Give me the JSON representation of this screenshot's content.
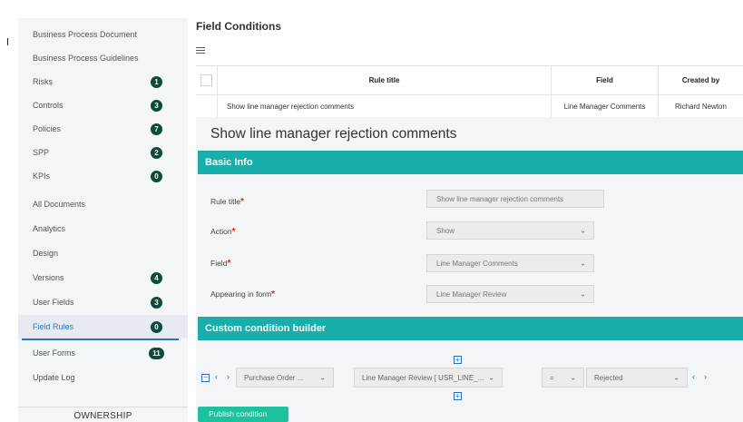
{
  "sidebar": {
    "items": [
      {
        "label": "Business Process Document",
        "badge": ""
      },
      {
        "label": "Business Process Guidelines",
        "badge": ""
      },
      {
        "label": "Risks",
        "badge": "1"
      },
      {
        "label": "Controls",
        "badge": "3"
      },
      {
        "label": "Policies",
        "badge": "7"
      },
      {
        "label": "SPP",
        "badge": "2"
      },
      {
        "label": "KPIs",
        "badge": "0"
      },
      {
        "label": "All Documents",
        "badge": ""
      },
      {
        "label": "Analytics",
        "badge": ""
      },
      {
        "label": "Design",
        "badge": ""
      },
      {
        "label": "Versions",
        "badge": "4"
      },
      {
        "label": "User Fields",
        "badge": "3"
      },
      {
        "label": "Field Rules",
        "badge": "0"
      },
      {
        "label": "User Forms",
        "badge": "11"
      },
      {
        "label": "Update Log",
        "badge": ""
      }
    ],
    "active_item": "Field Rules",
    "section_title": "OWNERSHIP"
  },
  "main": {
    "title": "Field Conditions",
    "menu_icon": "hamburger-icon",
    "table": {
      "headers": {
        "rule_title": "Rule title",
        "field": "Field",
        "created_by": "Created by"
      },
      "rows": [
        {
          "rule_title": "Show line manager rejection comments",
          "field": "Line Manager Comments",
          "created_by": "Richard Newton"
        }
      ]
    },
    "detail": {
      "title": "Show line manager rejection comments",
      "basic_info_label": "Basic Info",
      "fields": {
        "rule_title_label": "Rule title",
        "rule_title_value": "Show line manager rejection comments",
        "action_label": "Action",
        "action_value": "Show",
        "field_label": "Field",
        "field_value": "Line Manager Comments",
        "form_label": "Appearing in form",
        "form_value": "Line Manager Review"
      },
      "required_mark": "*",
      "custom_builder_label": "Custom condition builder",
      "condition": {
        "source": "Purchase Order ...",
        "field": "Line Manager Review [ USR_LINE_...",
        "operator": "=",
        "value": "Rejected"
      },
      "publish_label": "Publish condition"
    }
  },
  "glyphs": {
    "chevron": "⌄",
    "prev": "‹",
    "next": "›",
    "plus": "+",
    "minus": "−"
  },
  "colors": {
    "accent_teal": "#19aeaa",
    "publish_green": "#1ec19d",
    "badge_dark": "#0f4a3c",
    "link_blue": "#2c6fc2",
    "required_red": "#e2231a"
  }
}
